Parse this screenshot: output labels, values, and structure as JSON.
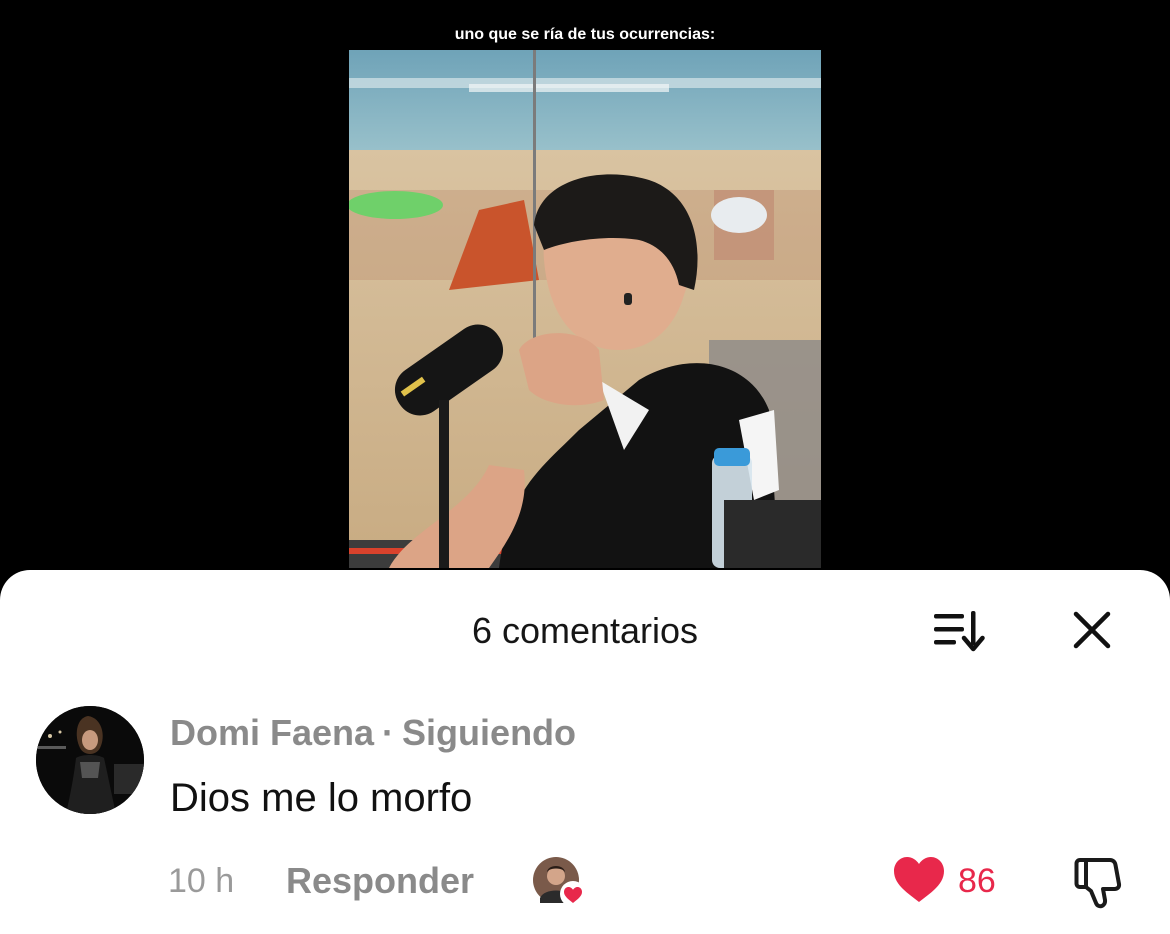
{
  "video": {
    "caption": "uno que se ría de tus ocurrencias:"
  },
  "comments_sheet": {
    "title": "6 comentarios",
    "sort_icon": "sort-descending-icon",
    "close_icon": "close-icon"
  },
  "comment": {
    "author": "Domi Faena",
    "separator": "·",
    "relationship": "Siguiendo",
    "text": "Dios me lo morfo",
    "time": "10 h",
    "reply_label": "Responder",
    "like_count": "86",
    "liked": true,
    "liked_by_creator": true
  },
  "colors": {
    "like_red": "#e8284b",
    "sheet_bg": "#ffffff",
    "page_bg": "#000000"
  }
}
